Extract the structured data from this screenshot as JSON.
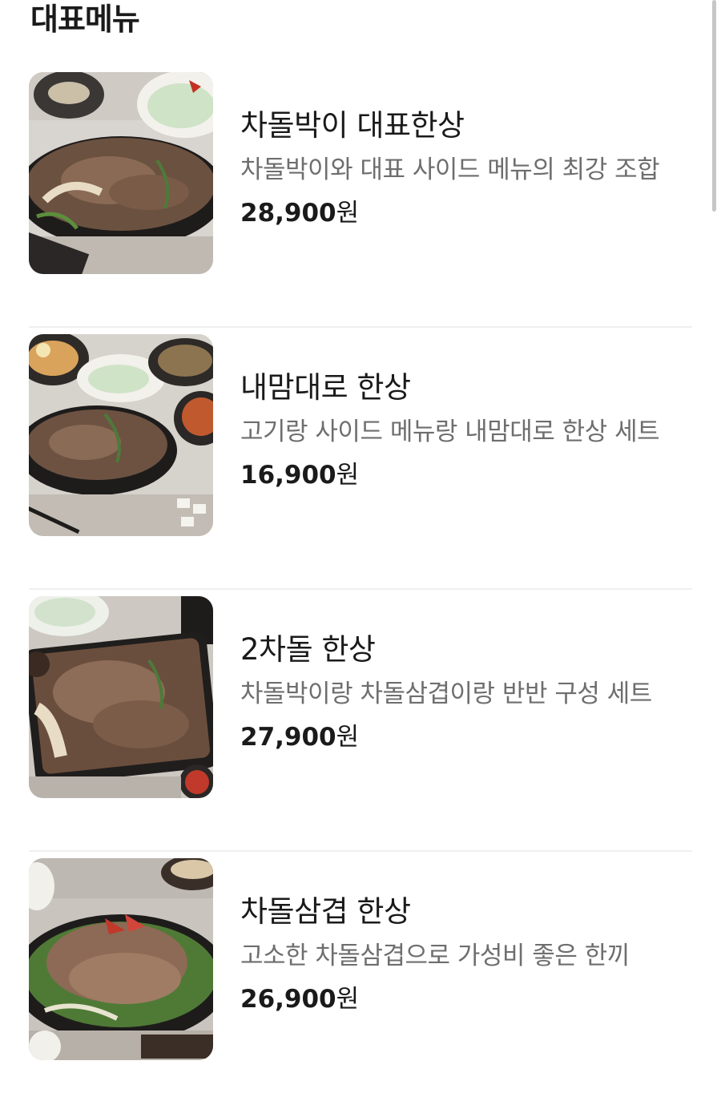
{
  "section": {
    "title": "대표메뉴"
  },
  "menu": {
    "items": [
      {
        "name": "차돌박이 대표한상",
        "description": "차돌박이와 대표 사이드 메뉴의 최강 조합",
        "price": "28,900",
        "currency": "원",
        "image": "food-photo-chadolbaki-set"
      },
      {
        "name": "내맘대로 한상",
        "description": "고기랑 사이드 메뉴랑 내맘대로 한상 세트",
        "price": "16,900",
        "currency": "원",
        "image": "food-photo-custom-set"
      },
      {
        "name": "2차돌 한상",
        "description": "차돌박이랑 차돌삼겹이랑 반반 구성 세트",
        "price": "27,900",
        "currency": "원",
        "image": "food-photo-half-half-set"
      },
      {
        "name": "차돌삼겹 한상",
        "description": "고소한 차돌삼겹으로 가성비 좋은 한끼",
        "price": "26,900",
        "currency": "원",
        "image": "food-photo-chadol-samgyeop-set"
      }
    ]
  }
}
